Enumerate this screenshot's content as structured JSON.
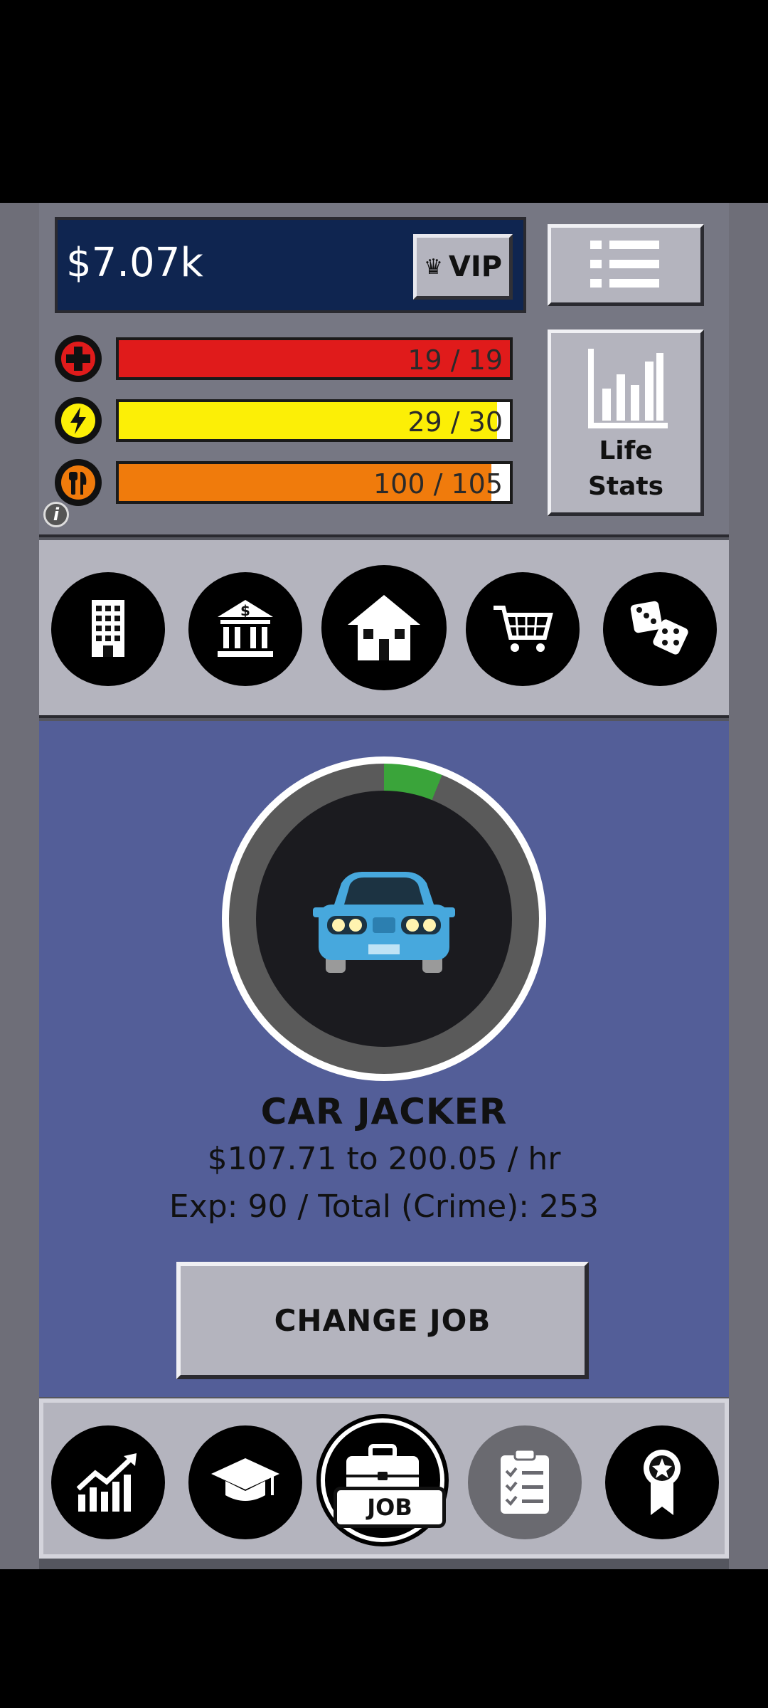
{
  "header": {
    "money": "$7.07k",
    "vip_label": "VIP",
    "life_stats_line1": "Life",
    "life_stats_line2": "Stats"
  },
  "stats": [
    {
      "name": "health",
      "icon": "health-cross-icon",
      "text": "19 / 19",
      "fill": 1.0,
      "color": "#e01b1b"
    },
    {
      "name": "energy",
      "icon": "lightning-icon",
      "text": "29 / 30",
      "fill": 0.967,
      "color": "#fcef06"
    },
    {
      "name": "hunger",
      "icon": "fork-knife-icon",
      "text": "100 / 105",
      "fill": 0.952,
      "color": "#f07b0c"
    }
  ],
  "location_nav": [
    "building-icon",
    "bank-icon",
    "house-icon",
    "shopping-cart-icon",
    "dice-icon"
  ],
  "job": {
    "title": "CAR JACKER",
    "pay": "$107.71 to 200.05 / hr",
    "exp": "Exp: 90 / Total (Crime): 253",
    "progress": 0.06,
    "change_label": "CHANGE JOB"
  },
  "bottom_nav": {
    "items": [
      "stocks-chart-icon",
      "graduation-cap-icon",
      "briefcase-icon",
      "clipboard-checklist-icon",
      "award-ribbon-icon"
    ],
    "job_tag": "JOB"
  }
}
